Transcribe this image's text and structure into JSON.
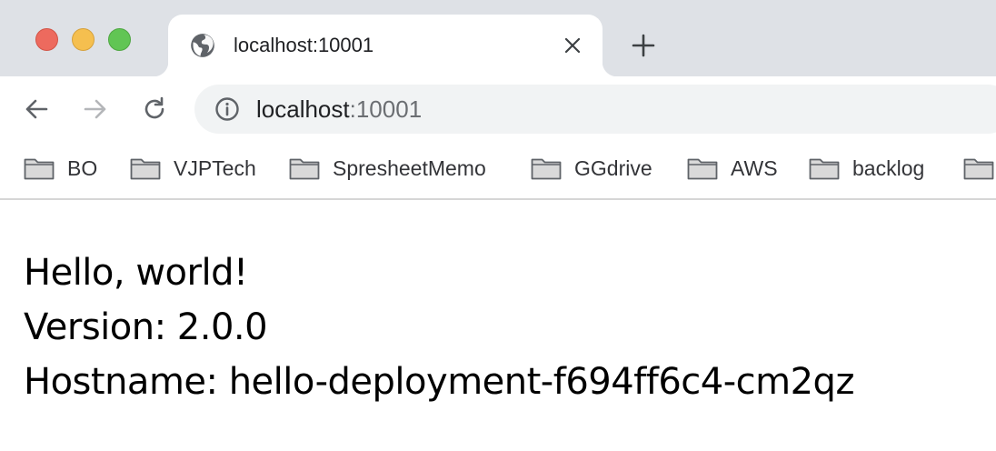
{
  "window": {
    "traffic_lights": [
      "close",
      "minimize",
      "zoom"
    ]
  },
  "tab": {
    "favicon": "globe-icon",
    "title": "localhost:10001"
  },
  "toolbar": {
    "url_host": "localhost",
    "url_port": ":10001"
  },
  "bookmarks": [
    {
      "label": "BO",
      "icon": "folder-icon"
    },
    {
      "label": "VJPTech",
      "icon": "folder-icon"
    },
    {
      "label": "SpresheetMemo",
      "icon": "folder-icon"
    },
    {
      "label": "GGdrive",
      "icon": "folder-icon"
    },
    {
      "label": "AWS",
      "icon": "folder-icon"
    },
    {
      "label": "backlog",
      "icon": "folder-icon"
    },
    {
      "label": "",
      "icon": "folder-icon"
    }
  ],
  "page": {
    "line1": "Hello, world!",
    "line2": "Version: 2.0.0",
    "line3": "Hostname: hello-deployment-f694ff6c4-cm2qz"
  },
  "colors": {
    "tabstrip_bg": "#dee1e6",
    "omnibox_bg": "#f1f3f4",
    "close_red": "#ed6a5e",
    "minimize_yellow": "#f5bf4f",
    "zoom_green": "#61c554"
  }
}
